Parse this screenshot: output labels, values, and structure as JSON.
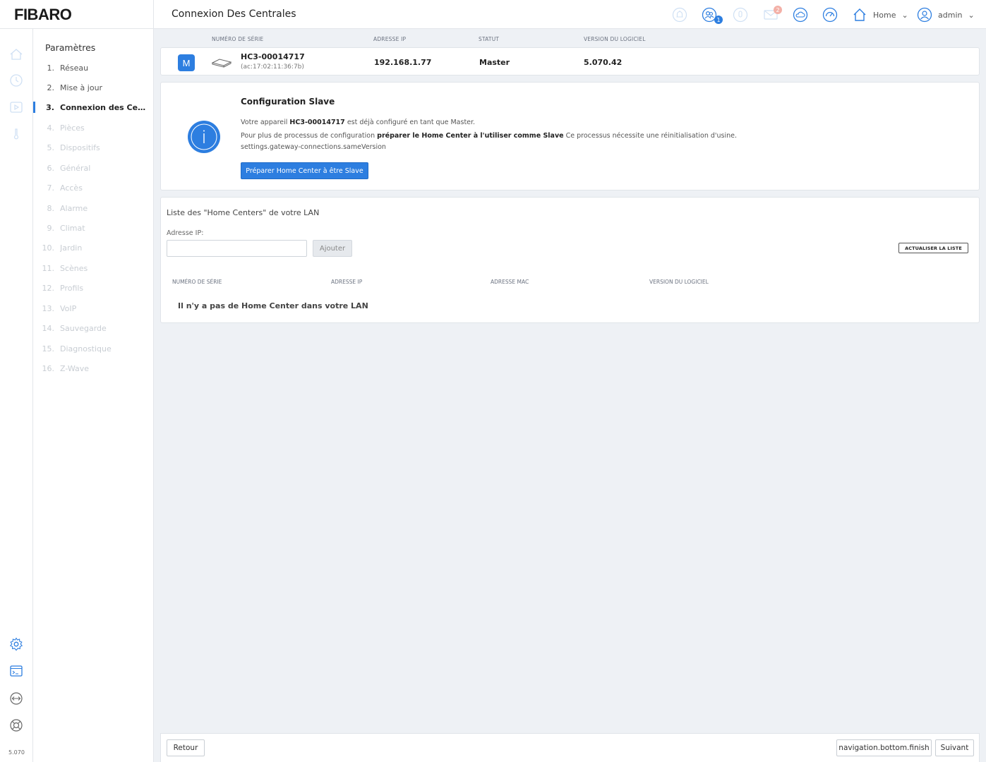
{
  "brand": {
    "logo_text": "FIBARO",
    "accent": "#2d7ee0"
  },
  "header": {
    "title": "Connexion Des Centrales",
    "icons": [
      {
        "name": "alarm-icon",
        "state": "disabled"
      },
      {
        "name": "users-icon",
        "badge": "1"
      },
      {
        "name": "microphone-icon",
        "state": "disabled"
      },
      {
        "name": "mail-icon",
        "badge": "2",
        "state": "disabled"
      },
      {
        "name": "weather-icon"
      },
      {
        "name": "dashboard-gauge-icon"
      }
    ],
    "home_label": "Home",
    "user_label": "admin"
  },
  "rail": {
    "top_icons": [
      "home-icon",
      "clock-icon",
      "play-icon",
      "thermometer-icon"
    ],
    "bottom_icons": [
      "settings-icon",
      "terminal-icon",
      "plugins-icon",
      "help-icon"
    ],
    "version": "5.070"
  },
  "sidebar": {
    "title": "Paramètres",
    "items": [
      {
        "num": "1.",
        "label": "Réseau",
        "state": "enabled"
      },
      {
        "num": "2.",
        "label": "Mise à jour",
        "state": "enabled"
      },
      {
        "num": "3.",
        "label": "Connexion des Centrales",
        "state": "active"
      },
      {
        "num": "4.",
        "label": "Pièces",
        "state": "disabled"
      },
      {
        "num": "5.",
        "label": "Dispositifs",
        "state": "disabled"
      },
      {
        "num": "6.",
        "label": "Général",
        "state": "disabled"
      },
      {
        "num": "7.",
        "label": "Accès",
        "state": "disabled"
      },
      {
        "num": "8.",
        "label": "Alarme",
        "state": "disabled"
      },
      {
        "num": "9.",
        "label": "Climat",
        "state": "disabled"
      },
      {
        "num": "10.",
        "label": "Jardin",
        "state": "disabled"
      },
      {
        "num": "11.",
        "label": "Scènes",
        "state": "disabled"
      },
      {
        "num": "12.",
        "label": "Profils",
        "state": "disabled"
      },
      {
        "num": "13.",
        "label": "VoIP",
        "state": "disabled"
      },
      {
        "num": "14.",
        "label": "Sauvegarde",
        "state": "disabled"
      },
      {
        "num": "15.",
        "label": "Diagnostique",
        "state": "disabled"
      },
      {
        "num": "16.",
        "label": "Z-Wave",
        "state": "disabled"
      }
    ]
  },
  "current_gateway": {
    "columns": [
      "NUMÉRO DE SÉRIE",
      "ADRESSE IP",
      "STATUT",
      "VERSION DU LOGICIEL"
    ],
    "badge": "M",
    "serial": "HC3-00014717",
    "mac": "(ac:17:02:11:36:7b)",
    "ip": "192.168.1.77",
    "status": "Master",
    "version": "5.070.42"
  },
  "slave_config": {
    "title": "Configuration Slave",
    "line1_prefix": "Votre appareil",
    "line1_serial": "HC3-00014717",
    "line1_suffix": "est déjà configuré en tant que Master.",
    "line2_prefix": "Pour plus de processus de configuration",
    "line2_bold": "préparer le Home Center à l'utiliser comme Slave",
    "line2_suffix": "Ce processus nécessite une réinitialisation d'usine.",
    "line3": "settings.gateway-connections.sameVersion",
    "button": "Préparer Home Center à être Slave"
  },
  "lan": {
    "title": "Liste des \"Home Centers\" de votre LAN",
    "ip_label": "Adresse IP:",
    "ip_value": "",
    "add_button": "Ajouter",
    "refresh_button": "ACTUALISER LA LISTE",
    "columns": [
      "NUMÉRO DE SÉRIE",
      "ADRESSE IP",
      "ADRESSE MAC",
      "VERSION DU LOGICIEL"
    ],
    "empty_message": "Il n'y a pas de Home Center dans votre LAN"
  },
  "footer": {
    "back": "Retour",
    "finish": "navigation.bottom.finish",
    "next": "Suivant"
  }
}
